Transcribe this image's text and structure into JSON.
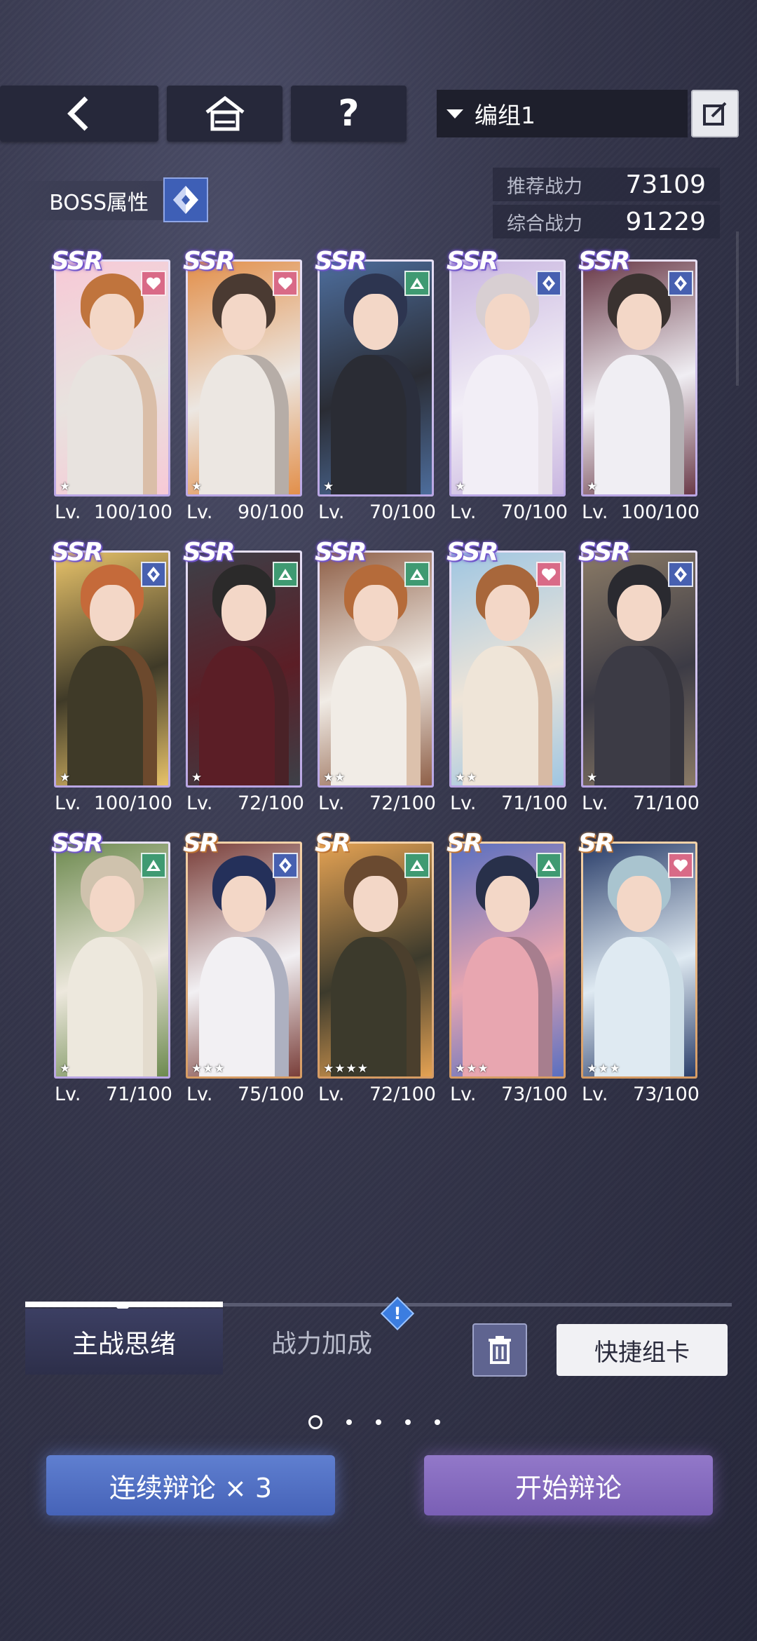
{
  "top_bar": {
    "back_icon": "chevron-left-icon",
    "home_icon": "home-icon",
    "help_label": "?",
    "group_label": "编组1",
    "edit_icon": "edit-icon"
  },
  "boss": {
    "label": "BOSS属性",
    "icon": "diamond-icon"
  },
  "power": {
    "recommended_label": "推荐战力",
    "recommended_value": "73109",
    "total_label": "综合战力",
    "total_value": "91229"
  },
  "cards": [
    {
      "rarity": "SSR",
      "attr": "heart",
      "stars": "★",
      "lv_label": "Lv.",
      "lv": "100/100",
      "palette": [
        "#c0743d",
        "#e8e3df",
        "#f7c9d6"
      ]
    },
    {
      "rarity": "SSR",
      "attr": "heart",
      "stars": "★",
      "lv_label": "Lv.",
      "lv": "90/100",
      "palette": [
        "#4a3a32",
        "#ece7e2",
        "#e28f4a"
      ]
    },
    {
      "rarity": "SSR",
      "attr": "triangle",
      "stars": "★",
      "lv_label": "Lv.",
      "lv": "70/100",
      "palette": [
        "#2d3550",
        "#2a2c34",
        "#4d6d9c"
      ]
    },
    {
      "rarity": "SSR",
      "attr": "diamond",
      "stars": "★",
      "lv_label": "Lv.",
      "lv": "70/100",
      "palette": [
        "#d8cfd2",
        "#f2eef6",
        "#c9b6e0"
      ]
    },
    {
      "rarity": "SSR",
      "attr": "diamond",
      "stars": "★",
      "lv_label": "Lv.",
      "lv": "100/100",
      "palette": [
        "#3a3230",
        "#f0eef3",
        "#6a3a48"
      ]
    },
    {
      "rarity": "SSR",
      "attr": "diamond",
      "stars": "★",
      "lv_label": "Lv.",
      "lv": "100/100",
      "palette": [
        "#c56a3a",
        "#3f3a28",
        "#e8c36a"
      ]
    },
    {
      "rarity": "SSR",
      "attr": "triangle",
      "stars": "★",
      "lv_label": "Lv.",
      "lv": "72/100",
      "palette": [
        "#2b2a2a",
        "#5b1e26",
        "#3d4048"
      ]
    },
    {
      "rarity": "SSR",
      "attr": "triangle",
      "stars": "★★",
      "lv_label": "Lv.",
      "lv": "72/100",
      "palette": [
        "#b56b3a",
        "#f1ece6",
        "#8f6048"
      ]
    },
    {
      "rarity": "SSR",
      "attr": "heart",
      "stars": "★★",
      "lv_label": "Lv.",
      "lv": "71/100",
      "palette": [
        "#a8673b",
        "#efe5d8",
        "#9fc6e2"
      ]
    },
    {
      "rarity": "SSR",
      "attr": "diamond",
      "stars": "★",
      "lv_label": "Lv.",
      "lv": "71/100",
      "palette": [
        "#2a2a30",
        "#3c3b45",
        "#8a7a66"
      ]
    },
    {
      "rarity": "SSR",
      "attr": "triangle",
      "stars": "★",
      "lv_label": "Lv.",
      "lv": "71/100",
      "palette": [
        "#cfc2ad",
        "#ede8dd",
        "#6d8a4f"
      ]
    },
    {
      "rarity": "SR",
      "attr": "diamond",
      "stars": "★★★",
      "lv_label": "Lv.",
      "lv": "75/100",
      "palette": [
        "#24305a",
        "#f2f0f3",
        "#7a3f3a"
      ]
    },
    {
      "rarity": "SR",
      "attr": "triangle",
      "stars": "★★★★",
      "lv_label": "Lv.",
      "lv": "72/100",
      "palette": [
        "#6a4a30",
        "#3c3a2c",
        "#e4a253"
      ]
    },
    {
      "rarity": "SR",
      "attr": "triangle",
      "stars": "★★★",
      "lv_label": "Lv.",
      "lv": "73/100",
      "palette": [
        "#28304a",
        "#e8a6b0",
        "#5a6fc0"
      ]
    },
    {
      "rarity": "SR",
      "attr": "heart",
      "stars": "★★★",
      "lv_label": "Lv.",
      "lv": "73/100",
      "palette": [
        "#a9c4cf",
        "#dfeaf2",
        "#2a3e6a"
      ]
    }
  ],
  "tabs": {
    "active": "主战思绪",
    "inactive": "战力加成",
    "badge": "!"
  },
  "actions": {
    "trash_icon": "trash-icon",
    "quick_label": "快捷组卡",
    "continue_label": "连续辩论 × 3",
    "start_label": "开始辩论"
  },
  "pager": {
    "count": 5,
    "active_index": 0
  },
  "colors": {
    "heart": "#d96a87",
    "triangle": "#3f9a72",
    "diamond": "#4760b0",
    "continue_btn": "#4e6cc0",
    "start_btn": "#8066b8"
  }
}
